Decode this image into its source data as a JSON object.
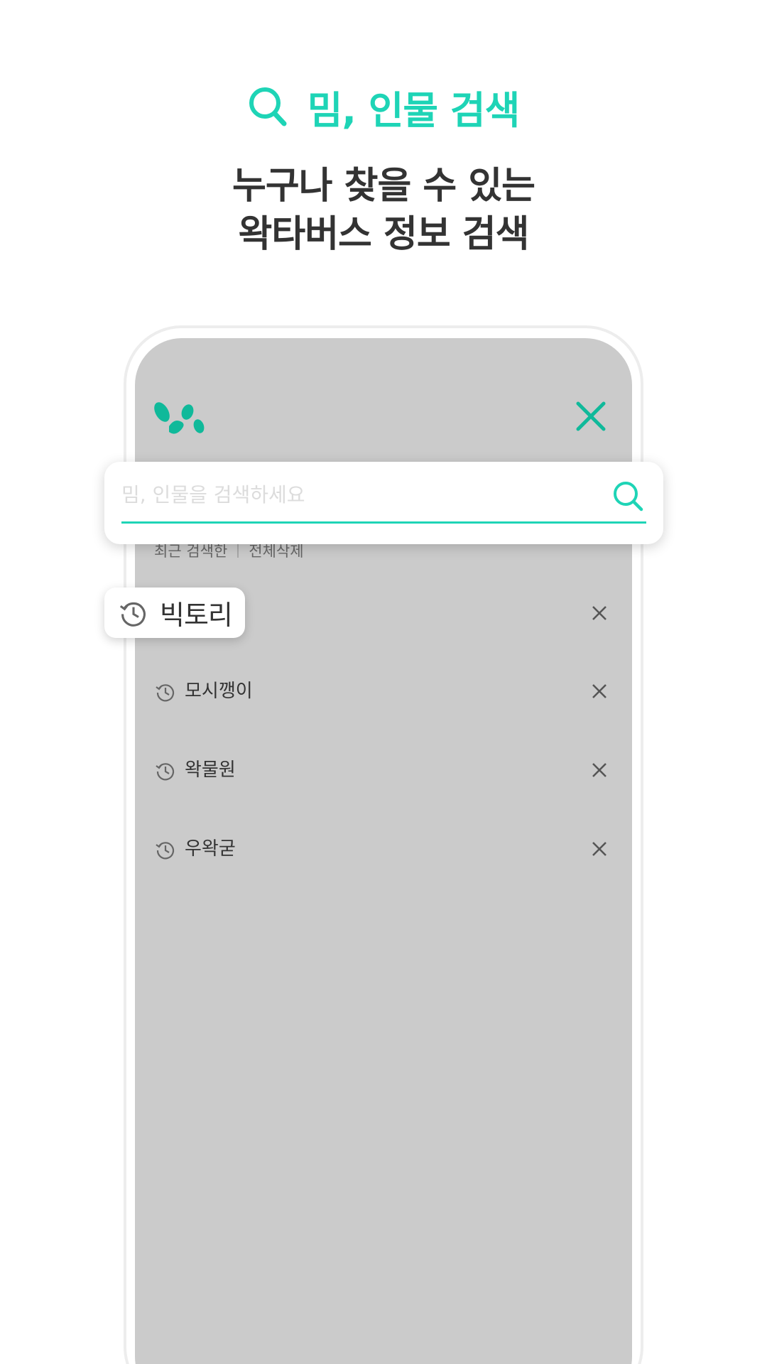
{
  "header": {
    "title": "밈, 인물 검색",
    "icon": "search-icon"
  },
  "subtitle": {
    "line1": "누구나 찾을 수 있는",
    "line2": "왁타버스 정보 검색"
  },
  "app": {
    "logo": "footprints-logo",
    "close_icon": "close-icon"
  },
  "search": {
    "placeholder": "밈, 인물을 검색하세요",
    "value": "",
    "button_icon": "search-icon"
  },
  "history": {
    "recent_label": "최근 검색한",
    "delete_all_label": "전체삭제",
    "items": [
      {
        "label": "빅토리",
        "icon": "history-icon",
        "highlighted": true
      },
      {
        "label": "모시깽이",
        "icon": "history-icon"
      },
      {
        "label": "왁물원",
        "icon": "history-icon"
      },
      {
        "label": "우왁굳",
        "icon": "history-icon"
      }
    ]
  },
  "colors": {
    "accent": "#1ed4b6",
    "text_dark": "#333333",
    "screen_bg": "#cbcbcb",
    "logo": "#10b99a"
  }
}
